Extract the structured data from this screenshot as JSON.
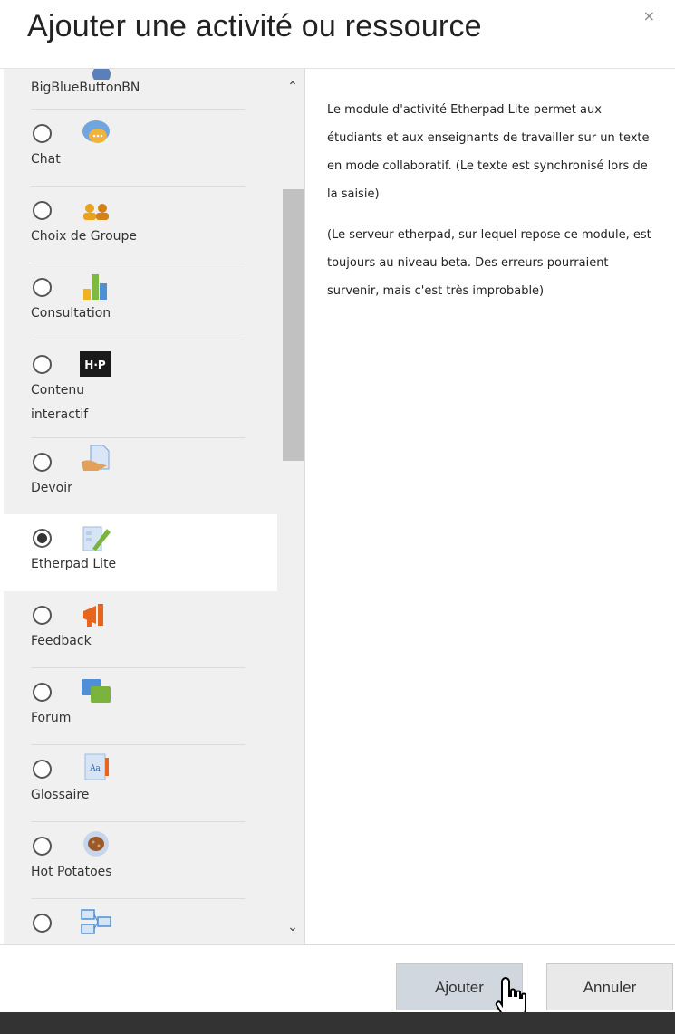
{
  "dialog": {
    "title": "Ajouter une activité ou ressource",
    "close_label": "×"
  },
  "list": {
    "items": [
      {
        "label": "BigBlueButtonBN",
        "icon": "bigbluebutton-icon",
        "selected": false
      },
      {
        "label": "Chat",
        "icon": "chat-icon",
        "selected": false
      },
      {
        "label": "Choix de Groupe",
        "icon": "group-choice-icon",
        "selected": false
      },
      {
        "label": "Consultation",
        "icon": "consultation-icon",
        "selected": false
      },
      {
        "label": "Contenu interactif",
        "icon": "h5p-icon",
        "selected": false
      },
      {
        "label": "Devoir",
        "icon": "assignment-icon",
        "selected": false
      },
      {
        "label": "Etherpad Lite",
        "icon": "etherpad-icon",
        "selected": true
      },
      {
        "label": "Feedback",
        "icon": "feedback-icon",
        "selected": false
      },
      {
        "label": "Forum",
        "icon": "forum-icon",
        "selected": false
      },
      {
        "label": "Glossaire",
        "icon": "glossary-icon",
        "selected": false
      },
      {
        "label": "Hot Potatoes",
        "icon": "hot-potatoes-icon",
        "selected": false
      },
      {
        "label": "",
        "icon": "lesson-icon",
        "selected": false
      }
    ],
    "scroll_up": "⌃",
    "scroll_down": "⌄"
  },
  "description": {
    "paragraph1": "Le module d'activité Etherpad Lite permet aux étudiants et aux enseignants de travailler sur un texte en mode collaboratif. (Le texte est synchronisé lors de la saisie)",
    "paragraph2": "(Le serveur etherpad, sur lequel repose ce module, est toujours au niveau beta. Des erreurs pourraient survenir, mais c'est très improbable)"
  },
  "footer": {
    "add_label": "Ajouter",
    "cancel_label": "Annuler"
  },
  "colors": {
    "selected_bg": "#ffffff",
    "list_bg": "#f0f0f0",
    "add_button_bg": "#d0d7df",
    "cancel_button_bg": "#e9e9e9"
  }
}
